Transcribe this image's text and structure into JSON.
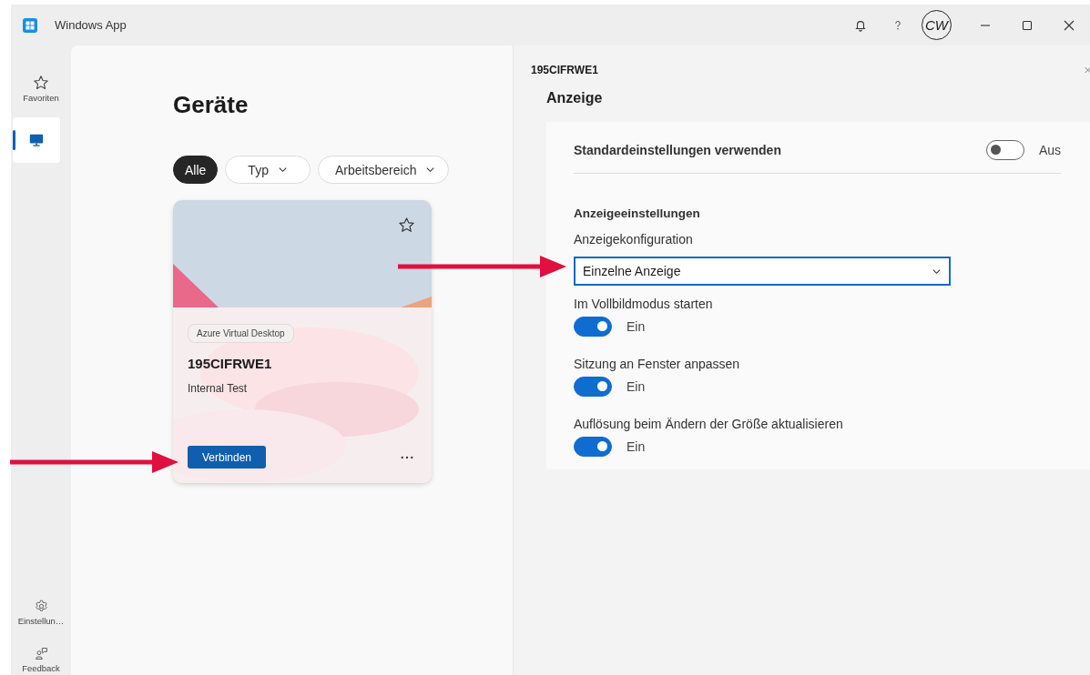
{
  "window": {
    "title": "Windows App",
    "avatar": "CW"
  },
  "sidebar": {
    "items": [
      {
        "kind": "favorites",
        "label": "Favoriten",
        "selected": false
      },
      {
        "kind": "devices",
        "selected": true
      }
    ],
    "bottom_items": [
      {
        "kind": "settings",
        "label": "Einstellun…"
      },
      {
        "kind": "feedback",
        "label": "Feedback"
      }
    ]
  },
  "main": {
    "heading": "Geräte",
    "filters": [
      {
        "label": "Alle",
        "selected": true,
        "dropdown": false
      },
      {
        "label": "Typ",
        "selected": false,
        "dropdown": true
      },
      {
        "label": "Arbeitsbereich",
        "selected": false,
        "dropdown": true
      }
    ],
    "devices": [
      {
        "tag": "Azure Virtual Desktop",
        "name": "195CIFRWE1",
        "description": "Internal Test",
        "favorite": false,
        "connect": "Verbinden"
      }
    ]
  },
  "panel": {
    "device": "195CIFRWE1",
    "section": "Anzeige",
    "default_settings": {
      "label": "Standardeinstellungen verwenden",
      "on": false,
      "state_label": "Aus"
    },
    "group_title": "Anzeigeeinstellungen",
    "config": {
      "label": "Anzeigekonfiguration",
      "value": "Einzelne Anzeige"
    },
    "toggles": [
      {
        "label": "Im Vollbildmodus starten",
        "on": true,
        "state_label": "Ein"
      },
      {
        "label": "Sitzung an Fenster anpassen",
        "on": true,
        "state_label": "Ein"
      },
      {
        "label": "Auflösung beim Ändern der Größe aktualisieren",
        "on": true,
        "state_label": "Ein"
      }
    ]
  }
}
